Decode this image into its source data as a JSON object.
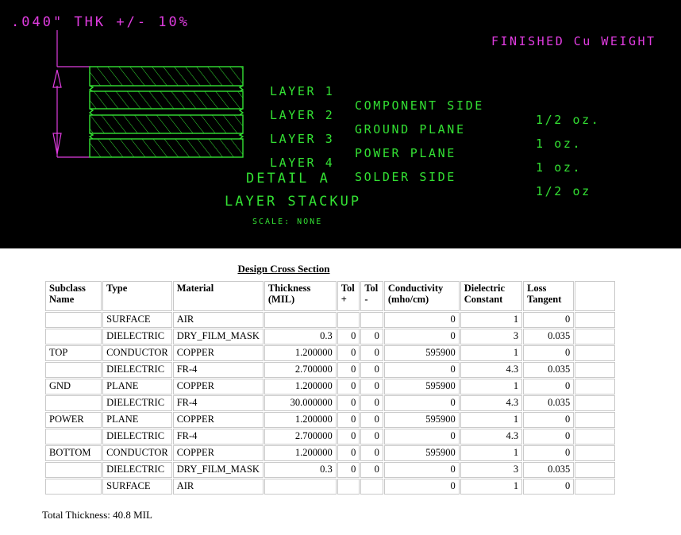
{
  "cad": {
    "thickness_note": ".040\" THK +/- 10%",
    "finished_cu_weight_title": "FINISHED Cu WEIGHT",
    "layers": [
      {
        "name": "LAYER 1",
        "desc": "COMPONENT SIDE",
        "weight": "1/2 oz."
      },
      {
        "name": "LAYER 2",
        "desc": "GROUND PLANE",
        "weight": "1 oz."
      },
      {
        "name": "LAYER 3",
        "desc": "POWER PLANE",
        "weight": "1 oz."
      },
      {
        "name": "LAYER 4",
        "desc": "SOLDER SIDE",
        "weight": "1/2 oz"
      }
    ],
    "detail_label": "DETAIL A",
    "detail_subtitle": "LAYER STACKUP",
    "scale_note": "SCALE: NONE",
    "colors": {
      "background": "#000000",
      "copper_green": "#33e033",
      "dimension_magenta": "#e03ce0"
    }
  },
  "table": {
    "title": "Design Cross Section",
    "headers": [
      "Subclass Name",
      "Type",
      "Material",
      "Thickness (MIL)",
      "Tol +",
      "Tol -",
      "Conductivity (mho/cm)",
      "Dielectric Constant",
      "Loss Tangent",
      ""
    ],
    "rows": [
      {
        "subclass": "",
        "type": "SURFACE",
        "material": "AIR",
        "thickness": "",
        "tol_plus": "",
        "tol_minus": "",
        "conductivity": "0",
        "dielectric": "1",
        "loss": "0",
        "last": ""
      },
      {
        "subclass": "",
        "type": "DIELECTRIC",
        "material": "DRY_FILM_MASK",
        "thickness": "0.3",
        "tol_plus": "0",
        "tol_minus": "0",
        "conductivity": "0",
        "dielectric": "3",
        "loss": "0.035",
        "last": ""
      },
      {
        "subclass": "TOP",
        "type": "CONDUCTOR",
        "material": "COPPER",
        "thickness": "1.200000",
        "tol_plus": "0",
        "tol_minus": "0",
        "conductivity": "595900",
        "dielectric": "1",
        "loss": "0",
        "last": ""
      },
      {
        "subclass": "",
        "type": "DIELECTRIC",
        "material": "FR-4",
        "thickness": "2.700000",
        "tol_plus": "0",
        "tol_minus": "0",
        "conductivity": "0",
        "dielectric": "4.3",
        "loss": "0.035",
        "last": ""
      },
      {
        "subclass": "GND",
        "type": "PLANE",
        "material": "COPPER",
        "thickness": "1.200000",
        "tol_plus": "0",
        "tol_minus": "0",
        "conductivity": "595900",
        "dielectric": "1",
        "loss": "0",
        "last": ""
      },
      {
        "subclass": "",
        "type": "DIELECTRIC",
        "material": "FR-4",
        "thickness": "30.000000",
        "tol_plus": "0",
        "tol_minus": "0",
        "conductivity": "0",
        "dielectric": "4.3",
        "loss": "0.035",
        "last": ""
      },
      {
        "subclass": "POWER",
        "type": "PLANE",
        "material": "COPPER",
        "thickness": "1.200000",
        "tol_plus": "0",
        "tol_minus": "0",
        "conductivity": "595900",
        "dielectric": "1",
        "loss": "0",
        "last": ""
      },
      {
        "subclass": "",
        "type": "DIELECTRIC",
        "material": "FR-4",
        "thickness": "2.700000",
        "tol_plus": "0",
        "tol_minus": "0",
        "conductivity": "0",
        "dielectric": "4.3",
        "loss": "0",
        "last": ""
      },
      {
        "subclass": "BOTTOM",
        "type": "CONDUCTOR",
        "material": "COPPER",
        "thickness": "1.200000",
        "tol_plus": "0",
        "tol_minus": "0",
        "conductivity": "595900",
        "dielectric": "1",
        "loss": "0",
        "last": ""
      },
      {
        "subclass": "",
        "type": "DIELECTRIC",
        "material": "DRY_FILM_MASK",
        "thickness": "0.3",
        "tol_plus": "0",
        "tol_minus": "0",
        "conductivity": "0",
        "dielectric": "3",
        "loss": "0.035",
        "last": ""
      },
      {
        "subclass": "",
        "type": "SURFACE",
        "material": "AIR",
        "thickness": "",
        "tol_plus": "",
        "tol_minus": "",
        "conductivity": "0",
        "dielectric": "1",
        "loss": "0",
        "last": ""
      }
    ],
    "total_thickness": "Total Thickness: 40.8 MIL"
  }
}
